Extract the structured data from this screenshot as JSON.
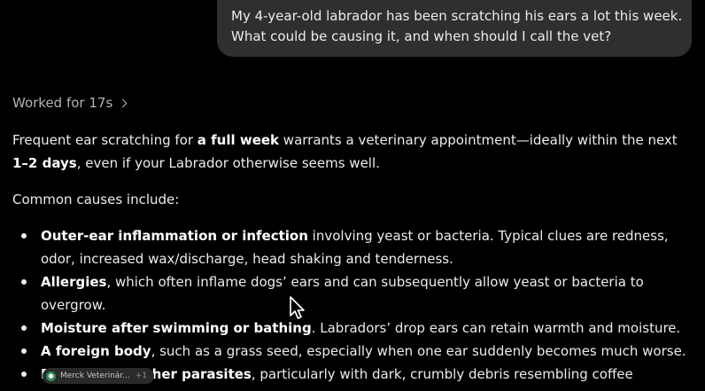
{
  "user_message": {
    "line1": "My 4-year-old labrador has been scratching his ears a lot this week.",
    "line2": "What could be causing it, and when should I call the vet?"
  },
  "worked": {
    "label": "Worked for 17s"
  },
  "answer": {
    "intro": {
      "p1": "Frequent ear scratching for ",
      "b1": "a full week",
      "p2": " warrants a veterinary appointment—ideally within the next ",
      "b2": "1–2 days",
      "p3": ", even if your Labrador otherwise seems well."
    },
    "causes_heading": "Common causes include:",
    "causes": [
      {
        "bold": "Outer-ear inflammation or infection",
        "text": " involving yeast or bacteria. Typical clues are redness, odor, increased wax/discharge, head shaking and tenderness."
      },
      {
        "bold": "Allergies",
        "text": ", which often inflame dogs’ ears and can subsequently allow yeast or bacteria to overgrow."
      },
      {
        "bold": "Moisture after swimming or bathing",
        "text": ". Labradors’ drop ears can retain warmth and moisture."
      },
      {
        "bold": "A foreign body",
        "text": ", such as a grass seed, especially when one ear suddenly becomes much worse."
      },
      {
        "bold": "Ear mites or other parasites",
        "text": ", particularly with dark, crumbly debris resembling coffee grounds."
      }
    ]
  },
  "source_chip": {
    "label": "Merck Veterinár...",
    "count": "+1",
    "icon": "globe-icon",
    "color": "#2e8b57"
  }
}
